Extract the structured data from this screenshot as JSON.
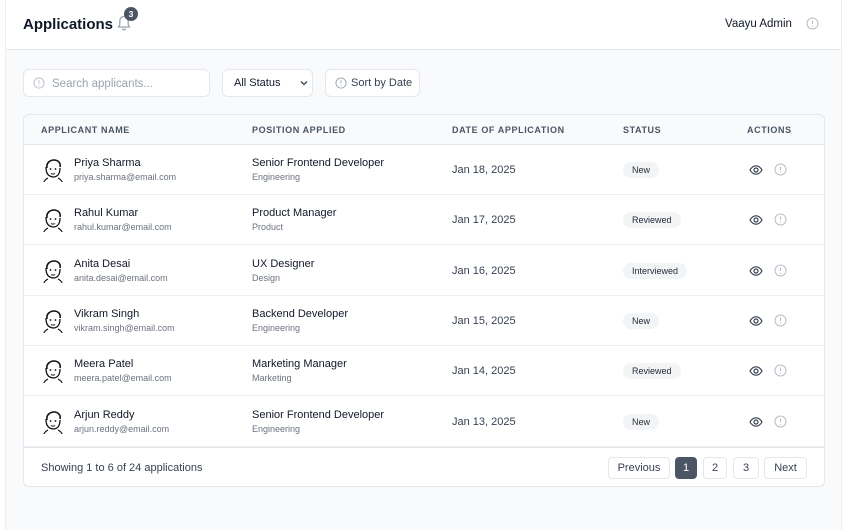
{
  "header": {
    "title": "Applications",
    "notification_count": "3",
    "user_name": "Vaayu Admin"
  },
  "toolbar": {
    "search_placeholder": "Search applicants...",
    "status_filter": "All Status",
    "sort_label": "Sort by Date"
  },
  "table": {
    "columns": [
      "APPLICANT NAME",
      "POSITION APPLIED",
      "DATE OF APPLICATION",
      "STATUS",
      "ACTIONS"
    ],
    "rows": [
      {
        "name": "Priya Sharma",
        "email": "priya.sharma@email.com",
        "position": "Senior Frontend Developer",
        "department": "Engineering",
        "date": "Jan 18, 2025",
        "status": "New"
      },
      {
        "name": "Rahul Kumar",
        "email": "rahul.kumar@email.com",
        "position": "Product Manager",
        "department": "Product",
        "date": "Jan 17, 2025",
        "status": "Reviewed"
      },
      {
        "name": "Anita Desai",
        "email": "anita.desai@email.com",
        "position": "UX Designer",
        "department": "Design",
        "date": "Jan 16, 2025",
        "status": "Interviewed"
      },
      {
        "name": "Vikram Singh",
        "email": "vikram.singh@email.com",
        "position": "Backend Developer",
        "department": "Engineering",
        "date": "Jan 15, 2025",
        "status": "New"
      },
      {
        "name": "Meera Patel",
        "email": "meera.patel@email.com",
        "position": "Marketing Manager",
        "department": "Marketing",
        "date": "Jan 14, 2025",
        "status": "Reviewed"
      },
      {
        "name": "Arjun Reddy",
        "email": "arjun.reddy@email.com",
        "position": "Senior Frontend Developer",
        "department": "Engineering",
        "date": "Jan 13, 2025",
        "status": "New"
      }
    ]
  },
  "pagination": {
    "summary": "Showing 1 to 6 of 24 applications",
    "previous_label": "Previous",
    "pages": [
      "1",
      "2",
      "3"
    ],
    "current_page": "1",
    "next_label": "Next"
  },
  "icons": {
    "notification": "bell-icon",
    "user": "info-circle-icon",
    "search": "info-circle-icon",
    "sort": "info-circle-icon",
    "view": "eye-icon",
    "more": "info-circle-icon",
    "avatar": "avatar-sketch-icon"
  },
  "colors": {
    "accent": "#4b5563",
    "badge_bg": "#f3f4f6",
    "border": "#e5e7eb"
  }
}
